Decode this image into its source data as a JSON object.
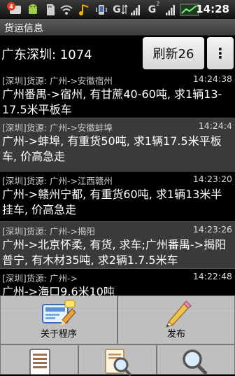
{
  "status_bar": {
    "notification_count": "4",
    "network_1": "G",
    "network_2": "G",
    "network_2_sup": "2",
    "time": "14:28"
  },
  "title_bar": {
    "title": "货运信息"
  },
  "header": {
    "region_count": "广东深圳: 1074",
    "refresh_label": "刷新26",
    "more_label": "⋮"
  },
  "list": {
    "items": [
      {
        "meta": "[深圳]货源: 广州->安徽宿州",
        "time": "14:24:38",
        "body": "广州番禺->宿州, 有甘蔗40-60吨, 求1辆13-17.5米平板车"
      },
      {
        "meta": "[深圳]货源: 广州->安徽蚌埠",
        "time": "14:24:4",
        "body": "广州->蚌埠, 有重货50吨, 求1辆17.5米平板车, 价高急走"
      },
      {
        "meta": "[深圳]货源: 广州->江西赣州",
        "time": "14:23:20",
        "body": "广州->赣州宁都, 有重货60吨, 求1辆13米半挂车, 价高急走"
      },
      {
        "meta": "[深圳]货源: 广州->揭阳",
        "time": "14:23:26",
        "body": "广州->北京怀柔, 有货, 求车;广州番禺->揭阳普宁, 有木材35吨, 求2辆1.7.5米车"
      },
      {
        "meta": "[深圳]货源: 广州->",
        "time": "14:22:48",
        "body": "广州->海口9.6米10吨"
      }
    ]
  },
  "menu": {
    "about_label": "关于程序",
    "publish_label": "发布"
  },
  "colors": {
    "accent": "#e23b1e",
    "title_bar": "#4a4a4a",
    "item_alt": "#3a3a3a"
  }
}
